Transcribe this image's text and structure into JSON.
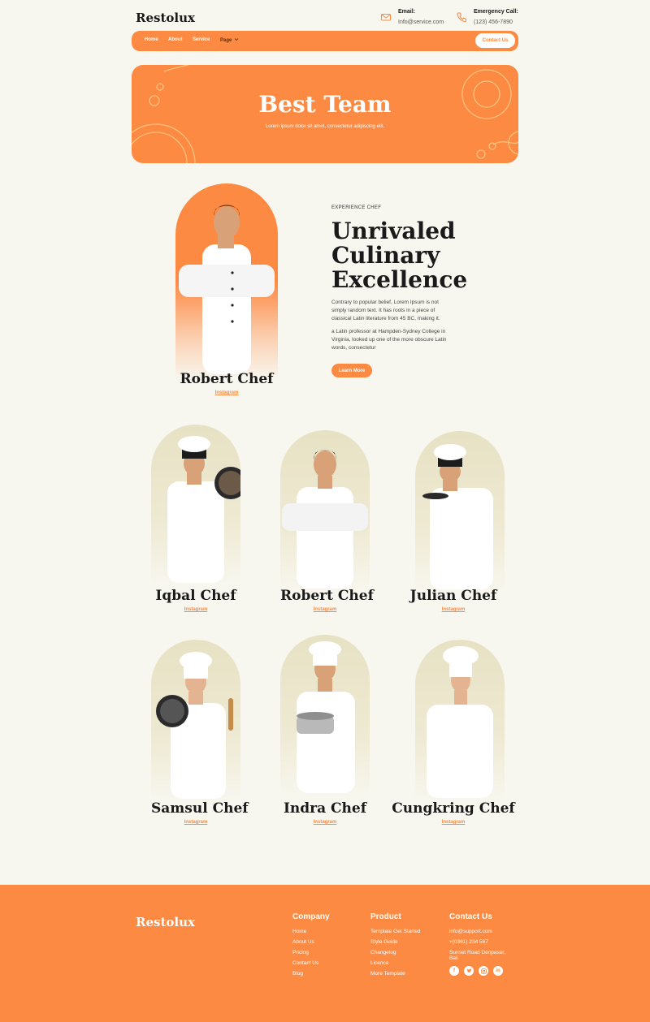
{
  "header": {
    "brand": "Restolux",
    "email_label": "Email:",
    "email_value": "Info@service.com",
    "phone_label": "Emergency Call:",
    "phone_value": "(123) 456-7890"
  },
  "nav": {
    "items": [
      "Home",
      "About",
      "Service",
      "Page"
    ],
    "contact_button": "Contact Us"
  },
  "hero": {
    "title": "Best Team",
    "subtitle": "Lorem ipsum dolor sit amet, consectetur adipiscing elit."
  },
  "featured": {
    "name": "Robert Chef",
    "link": "Instagram",
    "eyebrow": "EXPERIENCE CHEF",
    "title_line1": "Unrivaled",
    "title_line2": "Culinary",
    "title_line3": "Excellence",
    "paragraph1": "Contrary to popular belief, Lorem Ipsum is not simply random text. It has roots in a piece of classical Latin literature from 45 BC, making it.",
    "paragraph2": " a Latin professor at Hampden-Sydney College in Virginia, looked up one of the more obscure Latin words, consectetur",
    "button": "Learn More"
  },
  "team": [
    {
      "name": "Iqbal Chef",
      "link": "Instagram"
    },
    {
      "name": "Robert Chef",
      "link": "Instagram"
    },
    {
      "name": "Julian Chef",
      "link": "Instagram"
    },
    {
      "name": "Samsul Chef",
      "link": "Instagram"
    },
    {
      "name": "Indra Chef",
      "link": "Instagram"
    },
    {
      "name": "Cungkring Chef",
      "link": "Instagram"
    }
  ],
  "footer": {
    "brand": "Restolux",
    "company": {
      "title": "Company",
      "items": [
        "Home",
        "About Us",
        "Pricing",
        "Contact Us",
        "Blog"
      ]
    },
    "product": {
      "title": "Product",
      "items": [
        "Template Get Started",
        "Style Guide",
        "Changelog",
        "Licence",
        "More Template"
      ]
    },
    "contact": {
      "title": "Contact Us",
      "email": "info@support.com",
      "phone": "+(0361) 234 567",
      "address": "Sunset Road Denpasar, Bali"
    },
    "socials": [
      "facebook-icon",
      "twitter-icon",
      "instagram-icon",
      "linkedin-icon"
    ]
  },
  "colors": {
    "accent": "#fc8a43",
    "background": "#f8f7ef",
    "arch": "#e7e2c4"
  }
}
